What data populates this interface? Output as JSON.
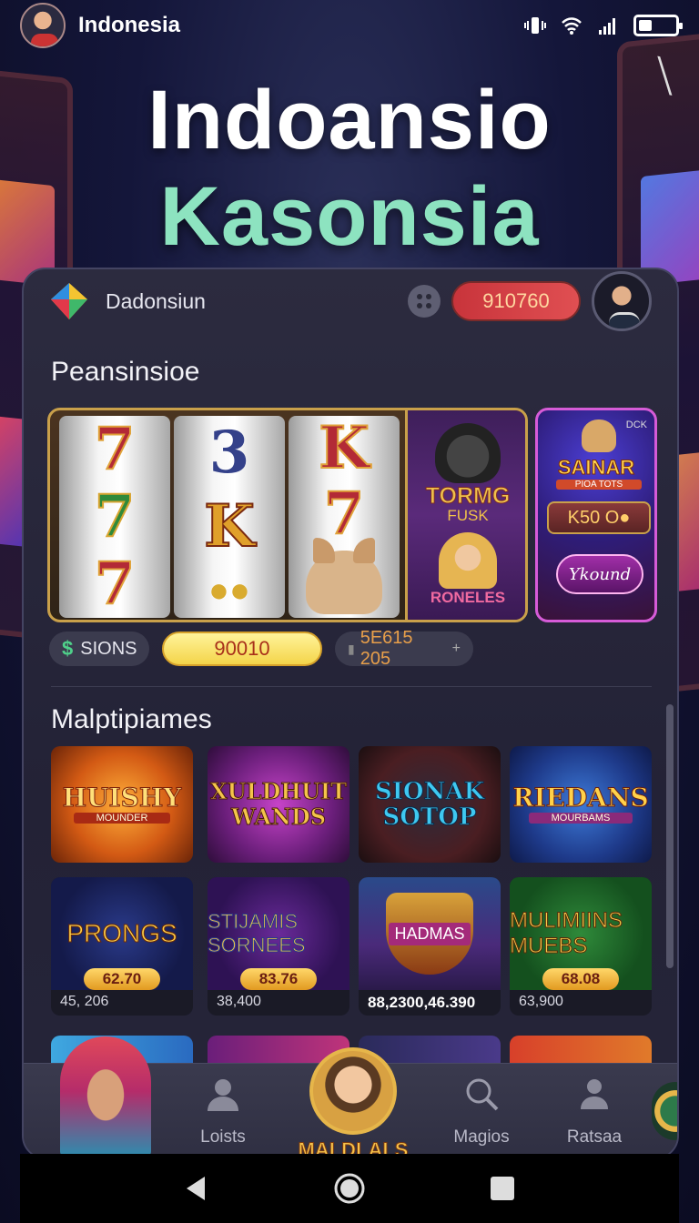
{
  "status_bar": {
    "country": "Indonesia",
    "icons": [
      "vibrate-icon",
      "wifi-icon",
      "signal-icon",
      "battery-icon"
    ]
  },
  "hero": {
    "line1": "Indoansio",
    "line2": "Kasonsia"
  },
  "app_header": {
    "brand": "Dadonsiun",
    "balance": "910760"
  },
  "featured": {
    "section_title": "Peansinsioe",
    "reels": [
      [
        "7",
        "7",
        "7"
      ],
      [
        "3",
        "K",
        ""
      ],
      [
        "K",
        "7",
        ""
      ]
    ],
    "side_panel_title": "TORMG",
    "side_panel_sub": "FUSK",
    "side_panel_bottom": "RONELES",
    "promo": {
      "tag": "DCK",
      "title": "SAINAR",
      "sub": "PIOA TOTS",
      "box": "K50 O●",
      "button": "Ykound"
    }
  },
  "chips": {
    "spins_label": "SIONS",
    "spins_symbol": "$",
    "amount": "90010",
    "bonus_prefix": "▮",
    "bonus": "5E615 205",
    "bonus_plus": "+"
  },
  "multigames": {
    "section_title": "Malptipiames",
    "row1": [
      {
        "name": "HUISHY",
        "sub": "MOUNDER"
      },
      {
        "name": "XULDHUIT WANDS",
        "sub": ""
      },
      {
        "name": "SIONAK SOTOP",
        "sub": ""
      },
      {
        "name": "RIEDANS",
        "sub": "MOURBAMS"
      }
    ],
    "row2": [
      {
        "name": "PRONGS",
        "price": "62.70",
        "count": "45, 206"
      },
      {
        "name": "STIJAMIS SORNEES",
        "price": "83.76",
        "count": "38,400"
      },
      {
        "name": "HADMAS",
        "price": "",
        "count": "88,2300,46.390"
      },
      {
        "name": "MULIMIINS MUEBS",
        "price": "68.08",
        "count": "63,900"
      }
    ]
  },
  "bottom_nav": {
    "items": [
      {
        "label": "Loists",
        "icon": "user-icon"
      },
      {
        "label": "MALDLALS",
        "icon": "avatar-icon"
      },
      {
        "label": "Magios",
        "icon": "magnifier-icon"
      },
      {
        "label": "Ratsaa",
        "icon": "profile-icon"
      }
    ]
  },
  "colors": {
    "accent_mint": "#8de3c0",
    "balance_red": "#d8403f",
    "gold": "#f0c14a",
    "card_bg": "#2c2b3f"
  }
}
